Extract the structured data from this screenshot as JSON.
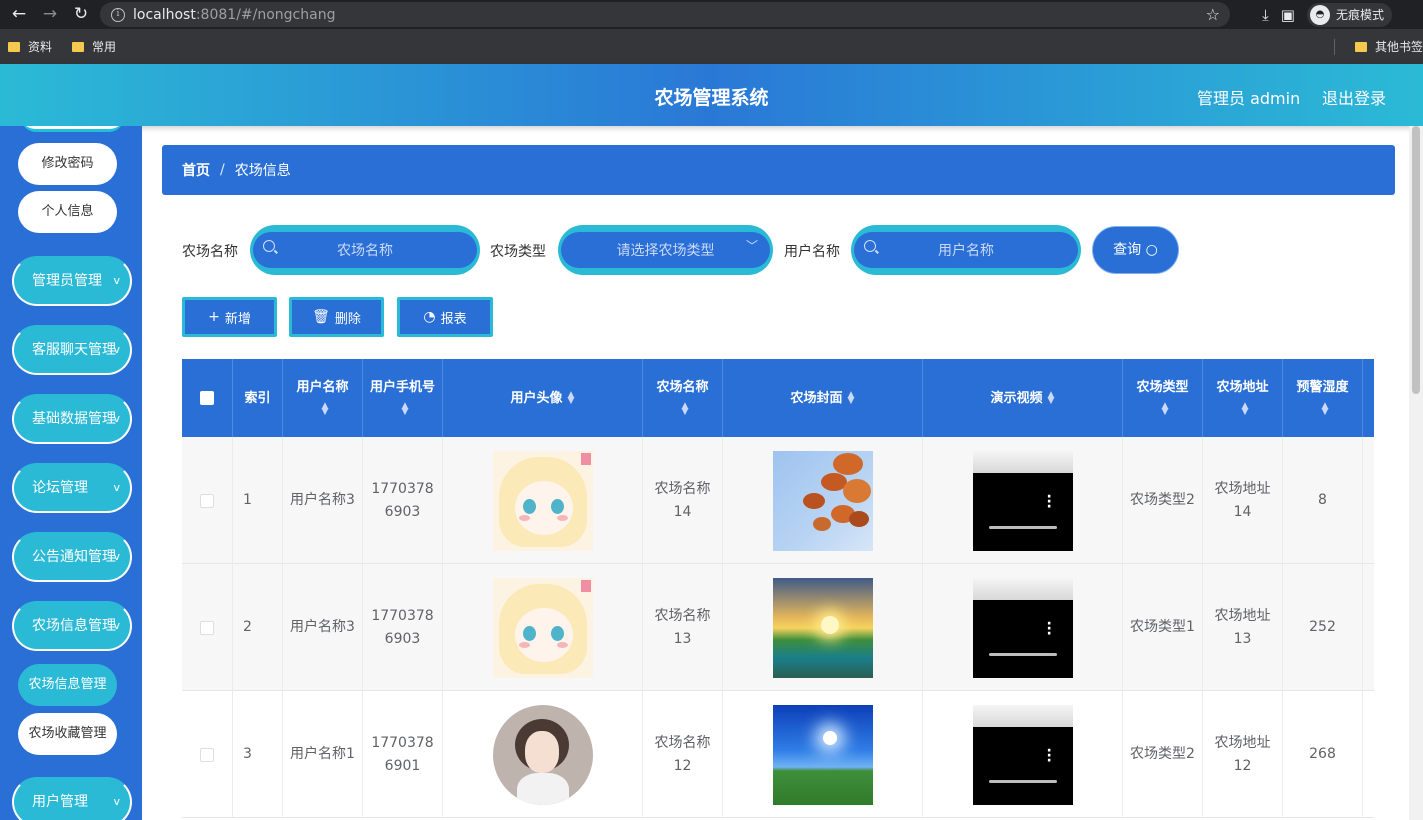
{
  "browser": {
    "url_host": "localhost",
    "url_rest": ":8081/#/nongchang",
    "incognito_label": "无痕模式",
    "bookmarks": [
      "资料",
      "常用"
    ],
    "other_bookmarks": "其他书签"
  },
  "header": {
    "title": "农场管理系统",
    "user": "管理员 admin",
    "logout": "退出登录"
  },
  "sidebar": {
    "top_items": [
      "修改密码",
      "个人信息"
    ],
    "menus": [
      {
        "label": "管理员管理",
        "chevron": "v"
      },
      {
        "label": "客服聊天管理",
        "chevron": "v"
      },
      {
        "label": "基础数据管理",
        "chevron": "v"
      },
      {
        "label": "论坛管理",
        "chevron": "v"
      },
      {
        "label": "公告通知管理",
        "chevron": "v"
      },
      {
        "label": "农场信息管理",
        "chevron": "v"
      }
    ],
    "submenu": [
      {
        "label": "农场信息管理",
        "active": true
      },
      {
        "label": "农场收藏管理",
        "active": false
      }
    ],
    "last_menu": {
      "label": "用户管理",
      "chevron": "v"
    }
  },
  "breadcrumb": {
    "home": "首页",
    "separator": "/",
    "current": "农场信息"
  },
  "search": {
    "farm_name_label": "农场名称",
    "farm_name_placeholder": "农场名称",
    "farm_type_label": "农场类型",
    "farm_type_placeholder": "请选择农场类型",
    "user_name_label": "用户名称",
    "user_name_placeholder": "用户名称",
    "query_button": "查询"
  },
  "actions": {
    "add": "新增",
    "delete": "删除",
    "report": "报表"
  },
  "table": {
    "columns": [
      {
        "key": "check",
        "label": ""
      },
      {
        "key": "index",
        "label": "索引"
      },
      {
        "key": "user_name",
        "label": "用户名称"
      },
      {
        "key": "user_phone",
        "label": "用户手机号"
      },
      {
        "key": "user_avatar",
        "label": "用户头像"
      },
      {
        "key": "farm_name",
        "label": "农场名称"
      },
      {
        "key": "farm_cover",
        "label": "农场封面"
      },
      {
        "key": "demo_video",
        "label": "演示视频"
      },
      {
        "key": "farm_type",
        "label": "农场类型"
      },
      {
        "key": "farm_address",
        "label": "农场地址"
      },
      {
        "key": "warn_humidity",
        "label": "预警湿度"
      }
    ],
    "rows": [
      {
        "index": "1",
        "user_name": "用户名称3",
        "user_phone": "17703786903",
        "avatar": "anime-girl-avatar",
        "farm_name": "农场名称14",
        "cover": "autumn-leaves-sky",
        "farm_type": "农场类型2",
        "farm_address": "农场地址14",
        "warn_humidity": "8"
      },
      {
        "index": "2",
        "user_name": "用户名称3",
        "user_phone": "17703786903",
        "avatar": "anime-girl-avatar",
        "farm_name": "农场名称13",
        "cover": "sunset-lake-landscape",
        "farm_type": "农场类型1",
        "farm_address": "农场地址13",
        "warn_humidity": "252"
      },
      {
        "index": "3",
        "user_name": "用户名称1",
        "user_phone": "17703786901",
        "avatar": "illustrated-woman-avatar",
        "farm_name": "农场名称12",
        "cover": "blue-sky-meadow",
        "farm_type": "农场类型2",
        "farm_address": "农场地址12",
        "warn_humidity": "268"
      }
    ]
  },
  "colors": {
    "primary": "#2a6fd6",
    "accent": "#2bbad6"
  }
}
